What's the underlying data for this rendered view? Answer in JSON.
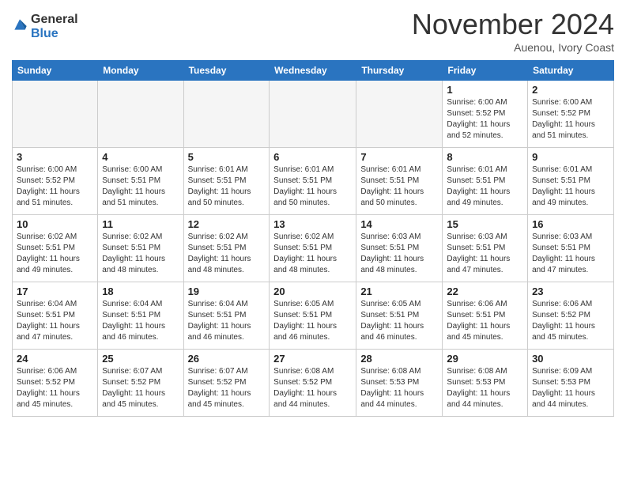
{
  "header": {
    "logo": {
      "general": "General",
      "blue": "Blue"
    },
    "title": "November 2024",
    "subtitle": "Auenou, Ivory Coast"
  },
  "calendar": {
    "days_of_week": [
      "Sunday",
      "Monday",
      "Tuesday",
      "Wednesday",
      "Thursday",
      "Friday",
      "Saturday"
    ],
    "weeks": [
      [
        {
          "day": "",
          "empty": true
        },
        {
          "day": "",
          "empty": true
        },
        {
          "day": "",
          "empty": true
        },
        {
          "day": "",
          "empty": true
        },
        {
          "day": "",
          "empty": true
        },
        {
          "day": "1",
          "sunrise": "Sunrise: 6:00 AM",
          "sunset": "Sunset: 5:52 PM",
          "daylight": "Daylight: 11 hours and 52 minutes."
        },
        {
          "day": "2",
          "sunrise": "Sunrise: 6:00 AM",
          "sunset": "Sunset: 5:52 PM",
          "daylight": "Daylight: 11 hours and 51 minutes."
        }
      ],
      [
        {
          "day": "3",
          "sunrise": "Sunrise: 6:00 AM",
          "sunset": "Sunset: 5:52 PM",
          "daylight": "Daylight: 11 hours and 51 minutes."
        },
        {
          "day": "4",
          "sunrise": "Sunrise: 6:00 AM",
          "sunset": "Sunset: 5:51 PM",
          "daylight": "Daylight: 11 hours and 51 minutes."
        },
        {
          "day": "5",
          "sunrise": "Sunrise: 6:01 AM",
          "sunset": "Sunset: 5:51 PM",
          "daylight": "Daylight: 11 hours and 50 minutes."
        },
        {
          "day": "6",
          "sunrise": "Sunrise: 6:01 AM",
          "sunset": "Sunset: 5:51 PM",
          "daylight": "Daylight: 11 hours and 50 minutes."
        },
        {
          "day": "7",
          "sunrise": "Sunrise: 6:01 AM",
          "sunset": "Sunset: 5:51 PM",
          "daylight": "Daylight: 11 hours and 50 minutes."
        },
        {
          "day": "8",
          "sunrise": "Sunrise: 6:01 AM",
          "sunset": "Sunset: 5:51 PM",
          "daylight": "Daylight: 11 hours and 49 minutes."
        },
        {
          "day": "9",
          "sunrise": "Sunrise: 6:01 AM",
          "sunset": "Sunset: 5:51 PM",
          "daylight": "Daylight: 11 hours and 49 minutes."
        }
      ],
      [
        {
          "day": "10",
          "sunrise": "Sunrise: 6:02 AM",
          "sunset": "Sunset: 5:51 PM",
          "daylight": "Daylight: 11 hours and 49 minutes."
        },
        {
          "day": "11",
          "sunrise": "Sunrise: 6:02 AM",
          "sunset": "Sunset: 5:51 PM",
          "daylight": "Daylight: 11 hours and 48 minutes."
        },
        {
          "day": "12",
          "sunrise": "Sunrise: 6:02 AM",
          "sunset": "Sunset: 5:51 PM",
          "daylight": "Daylight: 11 hours and 48 minutes."
        },
        {
          "day": "13",
          "sunrise": "Sunrise: 6:02 AM",
          "sunset": "Sunset: 5:51 PM",
          "daylight": "Daylight: 11 hours and 48 minutes."
        },
        {
          "day": "14",
          "sunrise": "Sunrise: 6:03 AM",
          "sunset": "Sunset: 5:51 PM",
          "daylight": "Daylight: 11 hours and 48 minutes."
        },
        {
          "day": "15",
          "sunrise": "Sunrise: 6:03 AM",
          "sunset": "Sunset: 5:51 PM",
          "daylight": "Daylight: 11 hours and 47 minutes."
        },
        {
          "day": "16",
          "sunrise": "Sunrise: 6:03 AM",
          "sunset": "Sunset: 5:51 PM",
          "daylight": "Daylight: 11 hours and 47 minutes."
        }
      ],
      [
        {
          "day": "17",
          "sunrise": "Sunrise: 6:04 AM",
          "sunset": "Sunset: 5:51 PM",
          "daylight": "Daylight: 11 hours and 47 minutes."
        },
        {
          "day": "18",
          "sunrise": "Sunrise: 6:04 AM",
          "sunset": "Sunset: 5:51 PM",
          "daylight": "Daylight: 11 hours and 46 minutes."
        },
        {
          "day": "19",
          "sunrise": "Sunrise: 6:04 AM",
          "sunset": "Sunset: 5:51 PM",
          "daylight": "Daylight: 11 hours and 46 minutes."
        },
        {
          "day": "20",
          "sunrise": "Sunrise: 6:05 AM",
          "sunset": "Sunset: 5:51 PM",
          "daylight": "Daylight: 11 hours and 46 minutes."
        },
        {
          "day": "21",
          "sunrise": "Sunrise: 6:05 AM",
          "sunset": "Sunset: 5:51 PM",
          "daylight": "Daylight: 11 hours and 46 minutes."
        },
        {
          "day": "22",
          "sunrise": "Sunrise: 6:06 AM",
          "sunset": "Sunset: 5:51 PM",
          "daylight": "Daylight: 11 hours and 45 minutes."
        },
        {
          "day": "23",
          "sunrise": "Sunrise: 6:06 AM",
          "sunset": "Sunset: 5:52 PM",
          "daylight": "Daylight: 11 hours and 45 minutes."
        }
      ],
      [
        {
          "day": "24",
          "sunrise": "Sunrise: 6:06 AM",
          "sunset": "Sunset: 5:52 PM",
          "daylight": "Daylight: 11 hours and 45 minutes."
        },
        {
          "day": "25",
          "sunrise": "Sunrise: 6:07 AM",
          "sunset": "Sunset: 5:52 PM",
          "daylight": "Daylight: 11 hours and 45 minutes."
        },
        {
          "day": "26",
          "sunrise": "Sunrise: 6:07 AM",
          "sunset": "Sunset: 5:52 PM",
          "daylight": "Daylight: 11 hours and 45 minutes."
        },
        {
          "day": "27",
          "sunrise": "Sunrise: 6:08 AM",
          "sunset": "Sunset: 5:52 PM",
          "daylight": "Daylight: 11 hours and 44 minutes."
        },
        {
          "day": "28",
          "sunrise": "Sunrise: 6:08 AM",
          "sunset": "Sunset: 5:53 PM",
          "daylight": "Daylight: 11 hours and 44 minutes."
        },
        {
          "day": "29",
          "sunrise": "Sunrise: 6:08 AM",
          "sunset": "Sunset: 5:53 PM",
          "daylight": "Daylight: 11 hours and 44 minutes."
        },
        {
          "day": "30",
          "sunrise": "Sunrise: 6:09 AM",
          "sunset": "Sunset: 5:53 PM",
          "daylight": "Daylight: 11 hours and 44 minutes."
        }
      ]
    ]
  }
}
